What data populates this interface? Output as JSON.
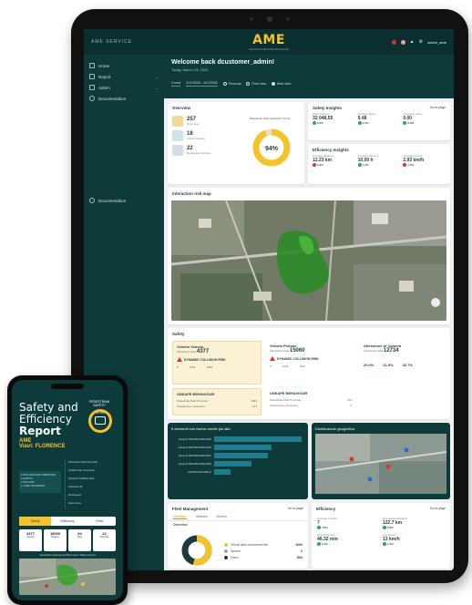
{
  "tablet": {
    "brand_left": "AME SERVICE",
    "logo": "AME",
    "logo_sub": "Advanced Mobility Enterprise",
    "user": "admin_ame",
    "sidebar": {
      "items": [
        {
          "label": "Home",
          "icon": "home-icon"
        },
        {
          "label": "Report",
          "icon": "report-icon"
        },
        {
          "label": "Admin",
          "icon": "admin-icon"
        },
        {
          "label": "Documentation",
          "icon": "info-icon"
        }
      ],
      "footer_item": "Documentation"
    },
    "welcome": {
      "title": "Welcome back dcustomer_admin!",
      "date": "Today, March 13, 2023",
      "filter_a": "3 mesi",
      "filter_b": "3/17/2025 - 3/17/2025",
      "radio_1": "Personal",
      "radio_2": "Fleet view",
      "radio_3": "Best view"
    },
    "overview": {
      "title": "Overview",
      "rows": [
        {
          "num": "257",
          "sub": "Drive logs",
          "color": "#f4d79a"
        },
        {
          "num": "18",
          "sub": "Active vehicles",
          "color": "#cfe3ea"
        },
        {
          "num": "22",
          "sub": "Registered vehicles",
          "color": "#d6dbe8"
        }
      ],
      "donut_title": "Pedestrian Risk Interaction Trend",
      "donut_value": "94%"
    },
    "safety_insights": {
      "title": "Safety Insights",
      "link": "Go to page",
      "kpis": [
        {
          "label": "Total distance",
          "value": "32 048,55",
          "delta": "6,6%",
          "up": true
        },
        {
          "label": "Average Score",
          "value": "9.48",
          "delta": "3,5%",
          "up": true
        },
        {
          "label": "Speeding event",
          "value": "0.00",
          "delta": "0,0%",
          "up": true
        }
      ]
    },
    "efficiency_insights": {
      "title": "Efficiency Insights",
      "kpis": [
        {
          "label": "Average distance",
          "value": "12.23 km",
          "delta": "3,2%",
          "up": false
        },
        {
          "label": "Average idle time",
          "value": "10.00 h",
          "delta": "1,4%",
          "up": true
        },
        {
          "label": "Average speed",
          "value": "2.93 km/h",
          "delta": "2,5%",
          "up": false
        }
      ]
    },
    "map": {
      "title": "Interaction risk map"
    },
    "safety": {
      "title": "Safety",
      "boxes": [
        {
          "title": "Veicolo Veicolo",
          "label": "Interazioni totali",
          "value": "4377",
          "warn": "DYNAMIC COLLISION RISK",
          "sub_a": "8",
          "sub_b": "7262",
          "sub_c": "4006",
          "color": "#fbf1d4"
        },
        {
          "title": "Veicolo Pedone",
          "label": "Interazioni totali",
          "value": "15060",
          "warn": "DYNAMIC COLLISION RISK",
          "sub_a": "0",
          "sub_b": "2243",
          "sub_c": "1037",
          "color": "#ffffff"
        },
        {
          "title": "Attenzione AI Camera",
          "label": "Interazioni totali",
          "value": "12734",
          "pct_a": "20.6%",
          "pct_b": "21.9%",
          "pct_c": "32.7%",
          "color": "#ffffff"
        }
      ],
      "unsafe_1": {
        "title": "UNSAFE BEHAVIOUR",
        "row_a": "Pedestrian Path Proximity",
        "val_a": "2353",
        "row_b": "Unsafe lane movement",
        "val_b": "107"
      },
      "unsafe_2": {
        "title": "UNSAFE BEHAVIOUR",
        "row_a": "Pedestrian Path Proximity",
        "val_a": "319",
        "row_b": "Unsafe lane movement",
        "val_b": "4"
      }
    },
    "risk_chart": {
      "title": "5 elementi con rischio medio più alto",
      "rows": [
        {
          "label": "Camerix SB-0000-0000-0019",
          "value": 94
        },
        {
          "label": "Camerix SB-0000-0000-0022",
          "value": 62
        },
        {
          "label": "Camerix SB-0000-0000-0017",
          "value": 58
        },
        {
          "label": "Camerix SB-0000-0000-0024",
          "value": 40
        },
        {
          "label": "AUDITSCAM 0001-9",
          "value": 18
        }
      ]
    },
    "geo": {
      "title": "Distribuzione geografica"
    },
    "fleet": {
      "title": "Fleet Management",
      "link": "Go to page",
      "tabs": [
        "Overview",
        "Vehicles",
        "Drivers"
      ],
      "sub": "Overview",
      "legend": [
        {
          "label": "Veicoli attivi recentemente",
          "value": "1000",
          "color": "#f4c22b"
        },
        {
          "label": "Spento",
          "value": "0",
          "color": "#9aa6a6"
        },
        {
          "label": "Falso",
          "value": "864",
          "color": "#1c3b3b"
        }
      ]
    },
    "efficiency": {
      "title": "Efficiency",
      "link": "Go to page",
      "kpis": [
        {
          "label": "Average velocity",
          "value": "7",
          "delta": "4.5%"
        },
        {
          "label": "Kilometres travelled",
          "value": "122.7 km",
          "delta": "8.8%"
        },
        {
          "label": "Operating time",
          "value": "46.32 min",
          "delta": "2.2%"
        },
        {
          "label": "Avg speed",
          "value": "13 km/h",
          "delta": "1.5%"
        }
      ]
    }
  },
  "phone": {
    "title_1": "Safety and",
    "title_2": "Efficiency",
    "title_3": "Report",
    "company": "AME",
    "location": "Viavi: FLORENCE",
    "badge": "PEDESTRIAN SAFETY",
    "gauge_value": "97.9%",
    "left_block": [
      "TOTAL DEVICES OBSERVED",
      "5 AUDITS",
      "3 OFFICES",
      "1 FLEET MANAGER"
    ],
    "side_list": [
      "Pedestrian Path Proximity",
      "Unsafe lane movement",
      "Dynamic Collision Risk",
      "Cameras off",
      "Overspeed",
      "Rest zones"
    ],
    "tabs": [
      "Safety",
      "Efficiency",
      "Fleet"
    ],
    "cards": [
      {
        "n": "4377",
        "l": "Veicolo"
      },
      {
        "n": "15060",
        "l": "Pedone"
      },
      {
        "n": "94",
        "l": "Risk"
      },
      {
        "n": "22",
        "l": "Vehicles"
      }
    ],
    "map_caption": "Interaction heatmap by Risk Level / Safety Report"
  }
}
